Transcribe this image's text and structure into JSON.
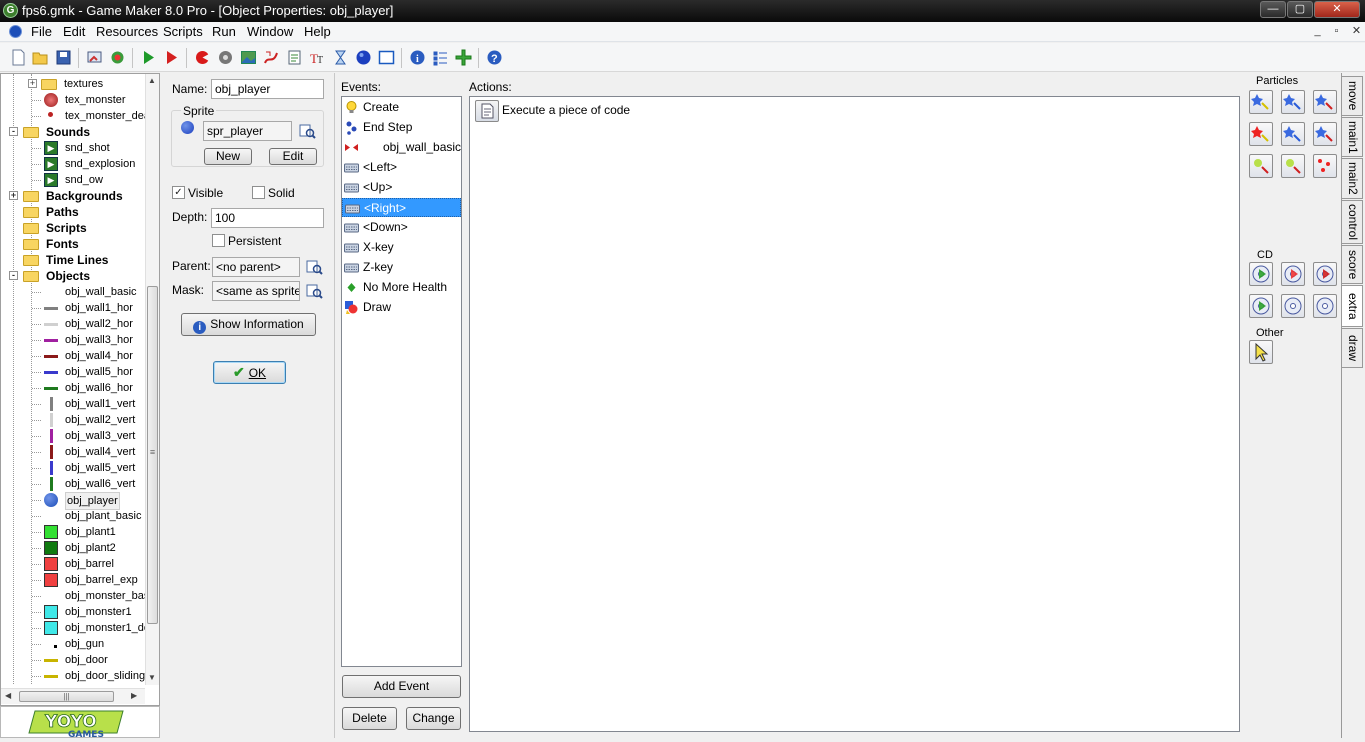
{
  "window": {
    "title": "fps6.gmk - Game Maker 8.0 Pro - [Object Properties: obj_player]",
    "min_glyph": "—",
    "max_glyph": "▢",
    "close_glyph": "✕"
  },
  "menu": {
    "items": [
      "File",
      "Edit",
      "Resources",
      "Scripts",
      "Run",
      "Window",
      "Help"
    ],
    "mdi": [
      "_",
      "▫",
      "✕"
    ]
  },
  "toolbar": {
    "icons": [
      "new-file",
      "open-file",
      "save",
      "create-exe",
      "publish",
      "run",
      "run-debug",
      "create-sprite",
      "create-sound",
      "create-background",
      "create-path",
      "create-script",
      "create-font",
      "create-timeline",
      "create-object",
      "create-room",
      "game-information",
      "global-settings",
      "extension-packages",
      "help"
    ]
  },
  "tree": {
    "rows": [
      {
        "label": "textures",
        "kind": "folder",
        "bold": false,
        "level": 2,
        "exp": "+"
      },
      {
        "label": "tex_monster",
        "kind": "tex-monster",
        "level": 3
      },
      {
        "label": "tex_monster_dea",
        "kind": "tex-monster-dead",
        "level": 3
      },
      {
        "label": "Sounds",
        "kind": "folder",
        "bold": true,
        "level": 1,
        "exp": "-"
      },
      {
        "label": "snd_shot",
        "kind": "sound",
        "level": 2
      },
      {
        "label": "snd_explosion",
        "kind": "sound",
        "level": 2
      },
      {
        "label": "snd_ow",
        "kind": "sound",
        "level": 2
      },
      {
        "label": "Backgrounds",
        "kind": "folder",
        "bold": true,
        "level": 1,
        "exp": "+"
      },
      {
        "label": "Paths",
        "kind": "folder",
        "bold": true,
        "level": 1
      },
      {
        "label": "Scripts",
        "kind": "folder",
        "bold": true,
        "level": 1
      },
      {
        "label": "Fonts",
        "kind": "folder",
        "bold": true,
        "level": 1
      },
      {
        "label": "Time Lines",
        "kind": "folder",
        "bold": true,
        "level": 1
      },
      {
        "label": "Objects",
        "kind": "folder",
        "bold": true,
        "level": 1,
        "exp": "-"
      },
      {
        "label": "obj_wall_basic",
        "kind": "none",
        "level": 2
      },
      {
        "label": "obj_wall1_hor",
        "kind": "hbar",
        "color": "#808080",
        "level": 2
      },
      {
        "label": "obj_wall2_hor",
        "kind": "hbar",
        "color": "#d0d0d0",
        "level": 2
      },
      {
        "label": "obj_wall3_hor",
        "kind": "hbar",
        "color": "#a020a0",
        "level": 2
      },
      {
        "label": "obj_wall4_hor",
        "kind": "hbar",
        "color": "#8b1a1a",
        "level": 2
      },
      {
        "label": "obj_wall5_hor",
        "kind": "hbar",
        "color": "#3a3acc",
        "level": 2
      },
      {
        "label": "obj_wall6_hor",
        "kind": "hbar",
        "color": "#1f7a1f",
        "level": 2
      },
      {
        "label": "obj_wall1_vert",
        "kind": "vbar",
        "color": "#808080",
        "level": 2
      },
      {
        "label": "obj_wall2_vert",
        "kind": "vbar",
        "color": "#d0d0d0",
        "level": 2
      },
      {
        "label": "obj_wall3_vert",
        "kind": "vbar",
        "color": "#a020a0",
        "level": 2
      },
      {
        "label": "obj_wall4_vert",
        "kind": "vbar",
        "color": "#8b1a1a",
        "level": 2
      },
      {
        "label": "obj_wall5_vert",
        "kind": "vbar",
        "color": "#3a3acc",
        "level": 2
      },
      {
        "label": "obj_wall6_vert",
        "kind": "vbar",
        "color": "#1f7a1f",
        "level": 2
      },
      {
        "label": "obj_player",
        "kind": "ball",
        "color": "#1c4eb8",
        "level": 2
      },
      {
        "label": "obj_plant_basic",
        "kind": "none",
        "level": 2
      },
      {
        "label": "obj_plant1",
        "kind": "square",
        "color": "#33e033",
        "level": 2
      },
      {
        "label": "obj_plant2",
        "kind": "square",
        "color": "#107a10",
        "level": 2
      },
      {
        "label": "obj_barrel",
        "kind": "square",
        "color": "#f04040",
        "level": 2
      },
      {
        "label": "obj_barrel_exp",
        "kind": "square",
        "color": "#f04040",
        "level": 2
      },
      {
        "label": "obj_monster_bas",
        "kind": "none",
        "level": 2
      },
      {
        "label": "obj_monster1",
        "kind": "square",
        "color": "#40e8e8",
        "level": 2
      },
      {
        "label": "obj_monster1_de",
        "kind": "square",
        "color": "#40e8e8",
        "level": 2
      },
      {
        "label": "obj_gun",
        "kind": "dot",
        "color": "#000000",
        "level": 2
      },
      {
        "label": "obj_door",
        "kind": "hbar",
        "color": "#c8b400",
        "level": 2
      },
      {
        "label": "obj_door_sliding",
        "kind": "hbar",
        "color": "#c8b400",
        "level": 2
      }
    ],
    "hscroll_thumb": "|||",
    "vscroll_thumb": "≡"
  },
  "logo": {
    "line1": "YOYO",
    "line2": "GAMES"
  },
  "object": {
    "name_label": "Name:",
    "name_value": "obj_player",
    "sprite_group": "Sprite",
    "sprite_value": "spr_player",
    "new_label": "New",
    "edit_label": "Edit",
    "visible_label": "Visible",
    "visible_checked": true,
    "solid_label": "Solid",
    "solid_checked": false,
    "depth_label": "Depth:",
    "depth_value": "100",
    "persistent_label": "Persistent",
    "persistent_checked": false,
    "parent_label": "Parent:",
    "parent_value": "<no parent>",
    "mask_label": "Mask:",
    "mask_value": "<same as sprite>",
    "show_info_label": "Show Information",
    "ok_label": "OK"
  },
  "events": {
    "title": "Events:",
    "items": [
      {
        "label": "Create",
        "icon": "bulb",
        "indent": false,
        "selected": false
      },
      {
        "label": "End Step",
        "icon": "step",
        "indent": false,
        "selected": false
      },
      {
        "label": "obj_wall_basic",
        "icon": "collision",
        "indent": true,
        "selected": false
      },
      {
        "label": "<Left>",
        "icon": "keyboard",
        "indent": false,
        "selected": false
      },
      {
        "label": "<Up>",
        "icon": "keyboard",
        "indent": false,
        "selected": false
      },
      {
        "label": "<Right>",
        "icon": "keyboard",
        "indent": false,
        "selected": true
      },
      {
        "label": "<Down>",
        "icon": "keyboard",
        "indent": false,
        "selected": false
      },
      {
        "label": "X-key",
        "icon": "keyboard",
        "indent": false,
        "selected": false
      },
      {
        "label": "Z-key",
        "icon": "keyboard",
        "indent": false,
        "selected": false
      },
      {
        "label": "No More Health",
        "icon": "diamond",
        "indent": false,
        "selected": false
      },
      {
        "label": "Draw",
        "icon": "draw",
        "indent": false,
        "selected": false
      }
    ],
    "add_label": "Add Event",
    "delete_label": "Delete",
    "change_label": "Change"
  },
  "actions": {
    "title": "Actions:",
    "items": [
      {
        "label": "Execute a piece of code",
        "icon": "code"
      }
    ]
  },
  "library": {
    "sections": [
      {
        "title": "Particles",
        "count": 9
      },
      {
        "title": "CD",
        "count": 6
      },
      {
        "title": "Other",
        "count": 1
      }
    ],
    "tabs": [
      {
        "label": "move",
        "active": false
      },
      {
        "label": "main1",
        "active": false
      },
      {
        "label": "main2",
        "active": false
      },
      {
        "label": "control",
        "active": false
      },
      {
        "label": "score",
        "active": false
      },
      {
        "label": "extra",
        "active": true
      },
      {
        "label": "draw",
        "active": false
      }
    ]
  }
}
